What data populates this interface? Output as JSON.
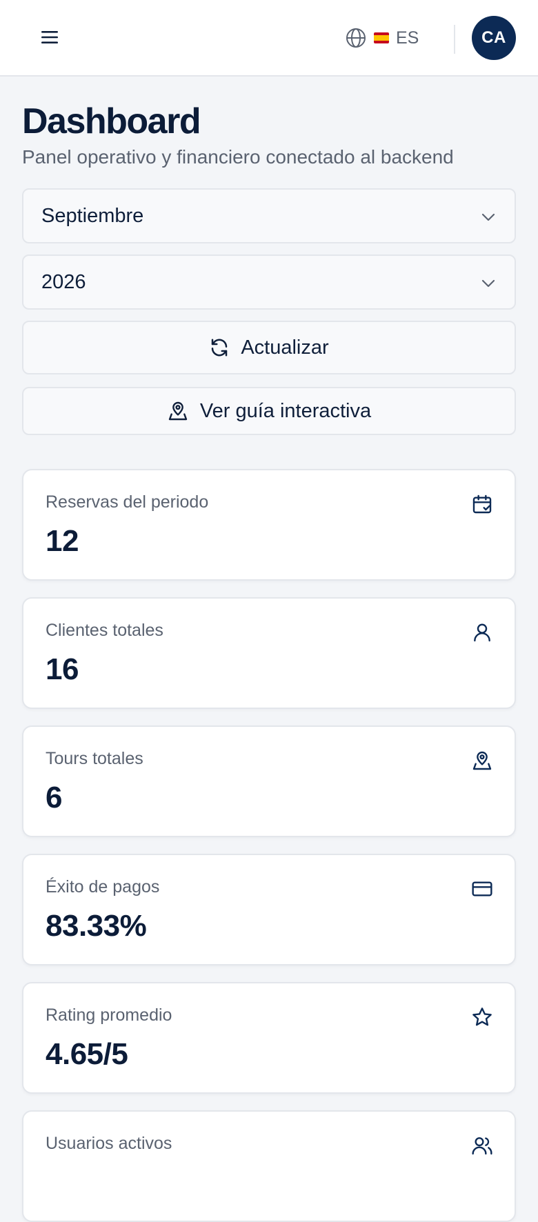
{
  "header": {
    "language_code": "ES",
    "avatar_initials": "CA"
  },
  "page": {
    "title": "Dashboard",
    "subtitle": "Panel operativo y financiero conectado al backend"
  },
  "filters": {
    "month": {
      "selected": "Septiembre"
    },
    "year": {
      "selected": "2026"
    }
  },
  "actions": {
    "refresh_label": "Actualizar",
    "guide_label": "Ver guía interactiva"
  },
  "stats": [
    {
      "label": "Reservas del periodo",
      "value": "12",
      "icon": "calendar-check-icon"
    },
    {
      "label": "Clientes totales",
      "value": "16",
      "icon": "user-icon"
    },
    {
      "label": "Tours totales",
      "value": "6",
      "icon": "map-pin-user-icon"
    },
    {
      "label": "Éxito de pagos",
      "value": "83.33%",
      "icon": "credit-card-icon"
    },
    {
      "label": "Rating promedio",
      "value": "4.65/5",
      "icon": "star-icon"
    },
    {
      "label": "Usuarios activos",
      "value": "",
      "icon": "users-icon"
    }
  ],
  "colors": {
    "brand_navy": "#0c2a55",
    "background": "#f3f5f8",
    "text_primary": "#0c1c38",
    "text_muted": "#5a6270",
    "border": "#e3e6eb"
  }
}
